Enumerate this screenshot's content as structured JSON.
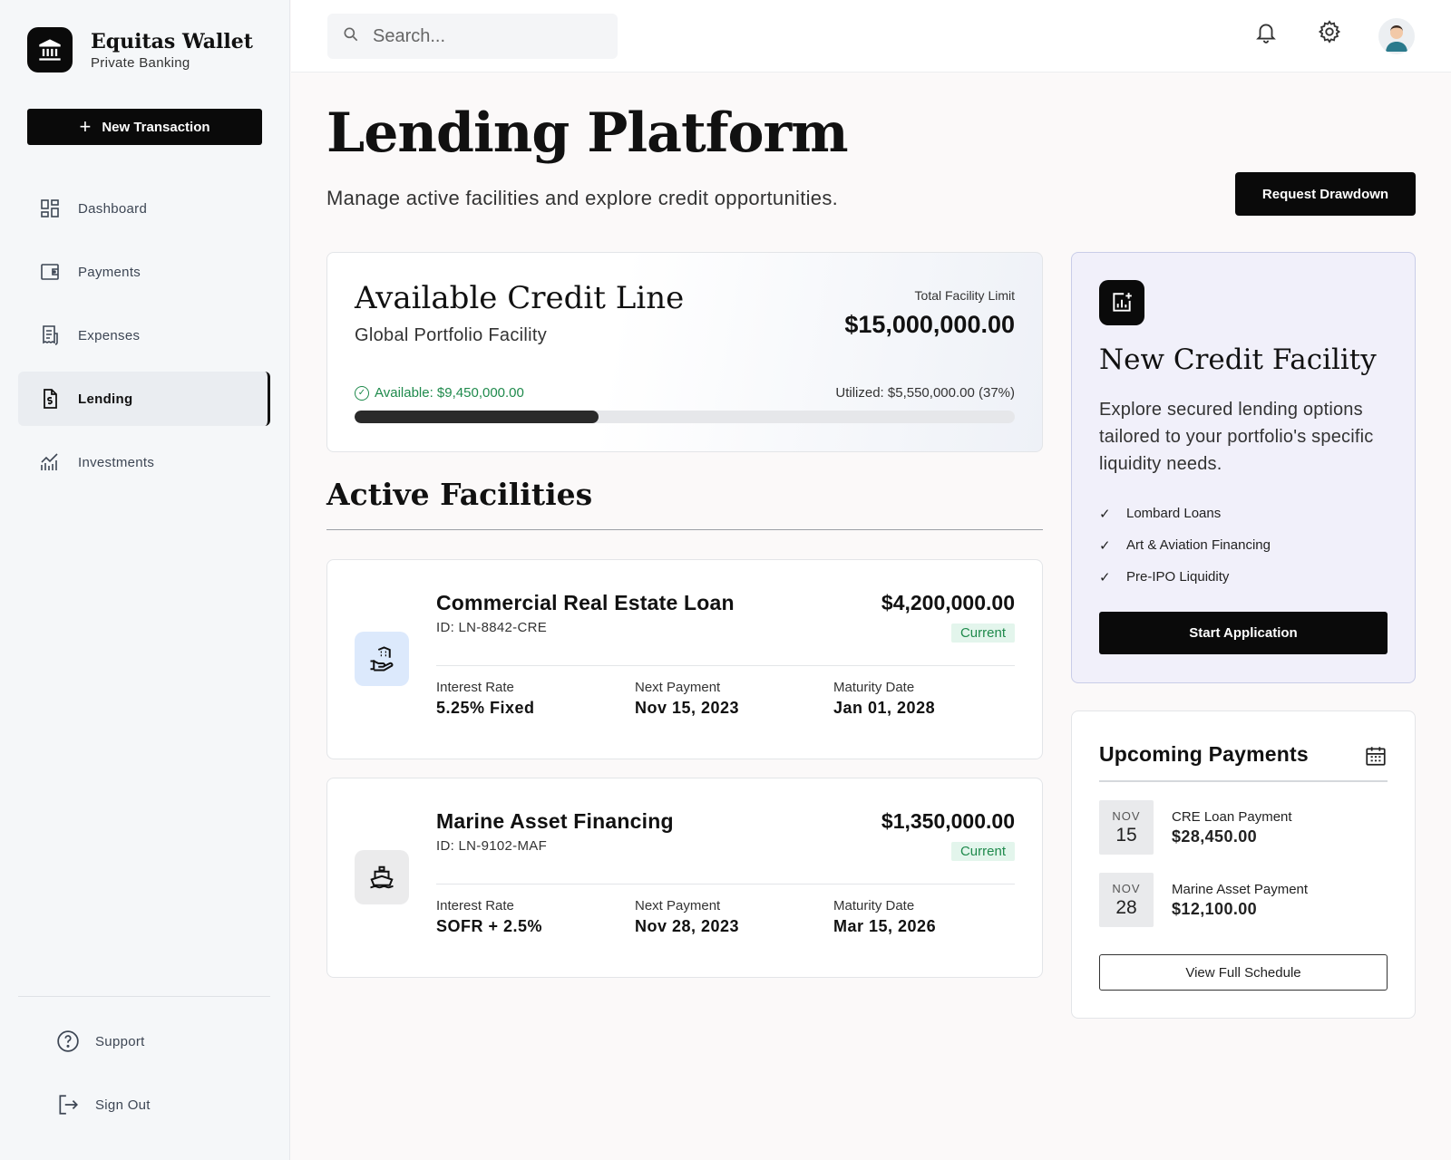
{
  "brand": {
    "name": "Equitas Wallet",
    "subtitle": "Private Banking"
  },
  "sidebar": {
    "new_transaction_label": "New Transaction",
    "items": [
      {
        "label": "Dashboard",
        "icon": "dashboard-icon",
        "active": false
      },
      {
        "label": "Payments",
        "icon": "wallet-icon",
        "active": false
      },
      {
        "label": "Expenses",
        "icon": "receipt-icon",
        "active": false
      },
      {
        "label": "Lending",
        "icon": "document-dollar-icon",
        "active": true
      },
      {
        "label": "Investments",
        "icon": "chart-icon",
        "active": false
      }
    ],
    "footer": [
      {
        "label": "Support",
        "icon": "help-icon"
      },
      {
        "label": "Sign Out",
        "icon": "logout-icon"
      }
    ]
  },
  "topbar": {
    "search_placeholder": "Search...",
    "icons": [
      "bell-icon",
      "gear-icon",
      "avatar"
    ]
  },
  "page": {
    "title": "Lending Platform",
    "subtitle": "Manage active facilities and explore credit opportunities.",
    "request_button": "Request Drawdown"
  },
  "credit_line": {
    "title": "Available Credit Line",
    "subtitle": "Global Portfolio Facility",
    "limit_label": "Total Facility Limit",
    "limit": "$15,000,000.00",
    "available": "Available: $9,450,000.00",
    "utilized": "Utilized: $5,550,000.00 (37%)",
    "utilized_fraction": 0.37
  },
  "facilities": {
    "title": "Active Facilities",
    "items": [
      {
        "name": "Commercial Real Estate Loan",
        "id": "ID: LN-8842-CRE",
        "amount": "$4,200,000.00",
        "status": "Current",
        "icon": "building-hand-icon",
        "interest_label": "Interest Rate",
        "interest": "5.25% Fixed",
        "next_label": "Next Payment",
        "next": "Nov 15, 2023",
        "maturity_label": "Maturity Date",
        "maturity": "Jan 01, 2028"
      },
      {
        "name": "Marine Asset Financing",
        "id": "ID: LN-9102-MAF",
        "amount": "$1,350,000.00",
        "status": "Current",
        "icon": "ship-icon",
        "interest_label": "Interest Rate",
        "interest": "SOFR + 2.5%",
        "next_label": "Next Payment",
        "next": "Nov 28, 2023",
        "maturity_label": "Maturity Date",
        "maturity": "Mar 15, 2026"
      }
    ]
  },
  "promo": {
    "title": "New Credit Facility",
    "description": "Explore secured lending options tailored to your portfolio's specific liquidity needs.",
    "features": [
      "Lombard Loans",
      "Art & Aviation Financing",
      "Pre-IPO Liquidity"
    ],
    "button": "Start Application"
  },
  "upcoming": {
    "title": "Upcoming Payments",
    "items": [
      {
        "month": "NOV",
        "day": "15",
        "name": "CRE Loan Payment",
        "amount": "$28,450.00"
      },
      {
        "month": "NOV",
        "day": "28",
        "name": "Marine Asset Payment",
        "amount": "$12,100.00"
      }
    ],
    "button": "View Full Schedule"
  },
  "colors": {
    "accent": "#0a0a0a",
    "success": "#1f8a4c",
    "promo_bg": "#f1f0fa"
  }
}
